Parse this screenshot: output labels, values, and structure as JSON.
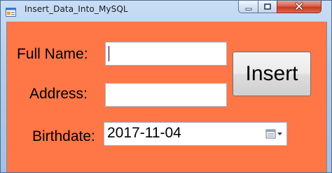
{
  "window": {
    "title": "Insert_Data_Into_MySQL",
    "icons": {
      "app": "form-window-icon",
      "minimize": "minimize-icon",
      "maximize": "maximize-icon",
      "close": "close-icon",
      "calendar": "calendar-dropdown-icon"
    }
  },
  "form": {
    "background_color": "#ff7647",
    "full_name": {
      "label": "Full Name:",
      "value": ""
    },
    "address": {
      "label": "Address:",
      "value": ""
    },
    "birthdate": {
      "label": "Birthdate:",
      "value": "2017-11-04"
    },
    "insert_label": "Insert"
  }
}
